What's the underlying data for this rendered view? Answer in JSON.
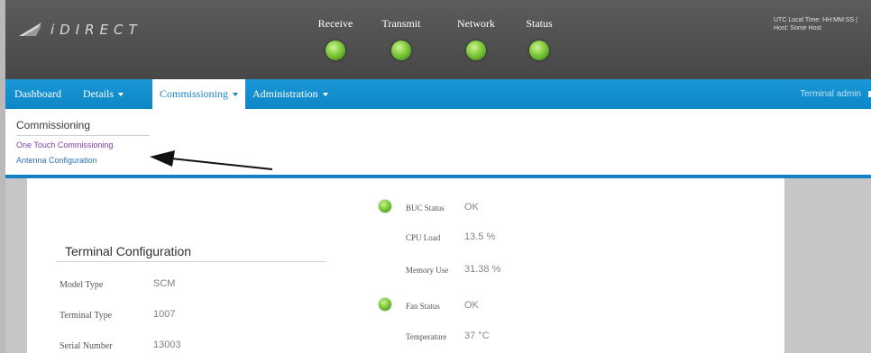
{
  "header": {
    "logo_text": "iDIRECT",
    "indicators": [
      {
        "label": "Receive",
        "state": "green"
      },
      {
        "label": "Transmit",
        "state": "green"
      },
      {
        "label": "Network",
        "state": "green"
      },
      {
        "label": "Status",
        "state": "green"
      }
    ],
    "utc_line1": "UTC Local Time: HH:MM:SS (",
    "utc_line2": "Host: Some Host"
  },
  "nav": {
    "items": [
      {
        "label": "Dashboard",
        "has_menu": false
      },
      {
        "label": "Details",
        "has_menu": true
      },
      {
        "label": "Commissioning",
        "has_menu": true,
        "active": true
      },
      {
        "label": "Administration",
        "has_menu": true
      }
    ],
    "user_label": "Terminal admin"
  },
  "dropdown": {
    "heading": "Commissioning",
    "links": [
      "One Touch Commissioning",
      "Antenna Configuration"
    ]
  },
  "terminal_config": {
    "title": "Terminal Configuration",
    "rows": [
      {
        "label": "Model Type",
        "value": "SCM"
      },
      {
        "label": "Terminal Type",
        "value": "1007"
      },
      {
        "label": "Serial Number",
        "value": "13003"
      }
    ]
  },
  "metrics": [
    {
      "label": "BUC Status",
      "value": "OK",
      "led": true
    },
    {
      "label": "CPU Load",
      "value": "13.5 %",
      "led": false
    },
    {
      "label": "Memory Use",
      "value": "31.38 %",
      "led": false
    },
    {
      "label": "Fan Status",
      "value": "OK",
      "led": true
    },
    {
      "label": "Temperature",
      "value": "37 °C",
      "led": false
    }
  ],
  "colors": {
    "header_bg": "#4f4f4f",
    "nav_blue": "#0d86c6",
    "led_green": "#8fd44a",
    "link_purple": "#7b3fa0",
    "link_blue": "#2f74b8"
  }
}
